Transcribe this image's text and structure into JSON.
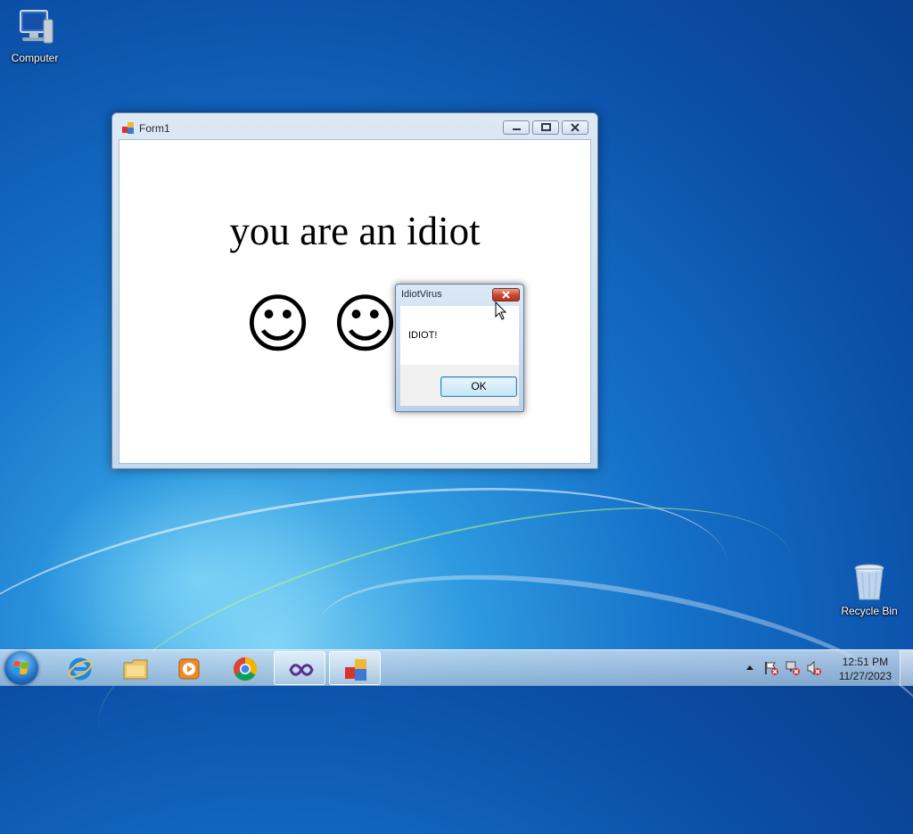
{
  "desktop": {
    "icons": [
      {
        "label": "Computer",
        "icon": "computer-icon"
      },
      {
        "label": "Recycle Bin",
        "icon": "recycle-bin-icon"
      }
    ]
  },
  "form1": {
    "title": "Form1",
    "headline": "you are an idiot",
    "smiley_glyph": "☺",
    "buttons": {
      "minimize": "minimize-icon",
      "maximize": "maximize-icon",
      "close": "close-icon"
    }
  },
  "dialog": {
    "title": "IdiotVirus",
    "message": "IDIOT!",
    "ok_label": "OK"
  },
  "taskbar": {
    "pinned": [
      {
        "name": "internet-explorer",
        "icon": "internet-explorer-icon"
      },
      {
        "name": "file-explorer",
        "icon": "folder-icon"
      },
      {
        "name": "media-player",
        "icon": "media-player-icon"
      },
      {
        "name": "chrome",
        "icon": "chrome-icon"
      },
      {
        "name": "visual-studio",
        "icon": "visual-studio-icon",
        "active": true
      },
      {
        "name": "form-app",
        "icon": "winforms-icon",
        "active": true
      }
    ],
    "clock": {
      "time": "12:51 PM",
      "date": "11/27/2023"
    }
  },
  "colors": {
    "desktop_blue": "#1570c8",
    "close_red": "#c74532",
    "ok_border": "#3c7fb1"
  }
}
